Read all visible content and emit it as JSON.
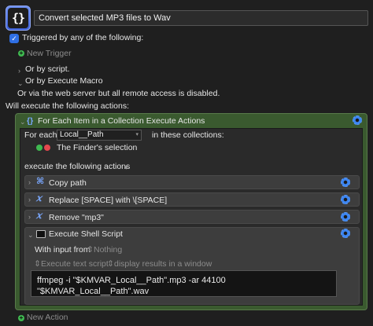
{
  "header": {
    "icon_glyph": "{}",
    "macro_name": "Convert selected MP3 files to Wav"
  },
  "triggers": {
    "checkbox_label": "Triggered by any of the following:",
    "new_trigger": "New Trigger",
    "or_script": "Or by script.",
    "or_execute_macro": "Or by Execute Macro",
    "or_web_server": "Or via the web server but all remote access is disabled."
  },
  "actions_heading": "Will execute the following actions:",
  "for_each": {
    "title": "For Each Item in a Collection Execute Actions",
    "for_each_label": "For each",
    "variable": "Local__Path",
    "in_collections": "in these collections:",
    "collection": "The Finder's selection",
    "execute_label": "execute the following actions",
    "sub_actions": [
      {
        "icon": "command-icon",
        "label": "Copy path"
      },
      {
        "icon": "x-icon",
        "label": "Replace [SPACE] with \\[SPACE]"
      },
      {
        "icon": "x-icon",
        "label": "Remove \"mp3\""
      }
    ],
    "shell": {
      "title": "Execute Shell Script",
      "with_input_label": "With input from",
      "input_value": "Nothing",
      "execute_mode": "Execute text script",
      "display_mode": "display results in a window",
      "script": "ffmpeg -i \"$KMVAR_Local__Path\".mp3 -ar 44100 \"$KMVAR_Local__Path\".wav"
    }
  },
  "new_action": "New Action",
  "colors": {
    "accent_blue": "#2f6fe4",
    "group_green": "#3a5a2f",
    "add_green": "#3fb950",
    "delete_red": "#e5484d"
  }
}
